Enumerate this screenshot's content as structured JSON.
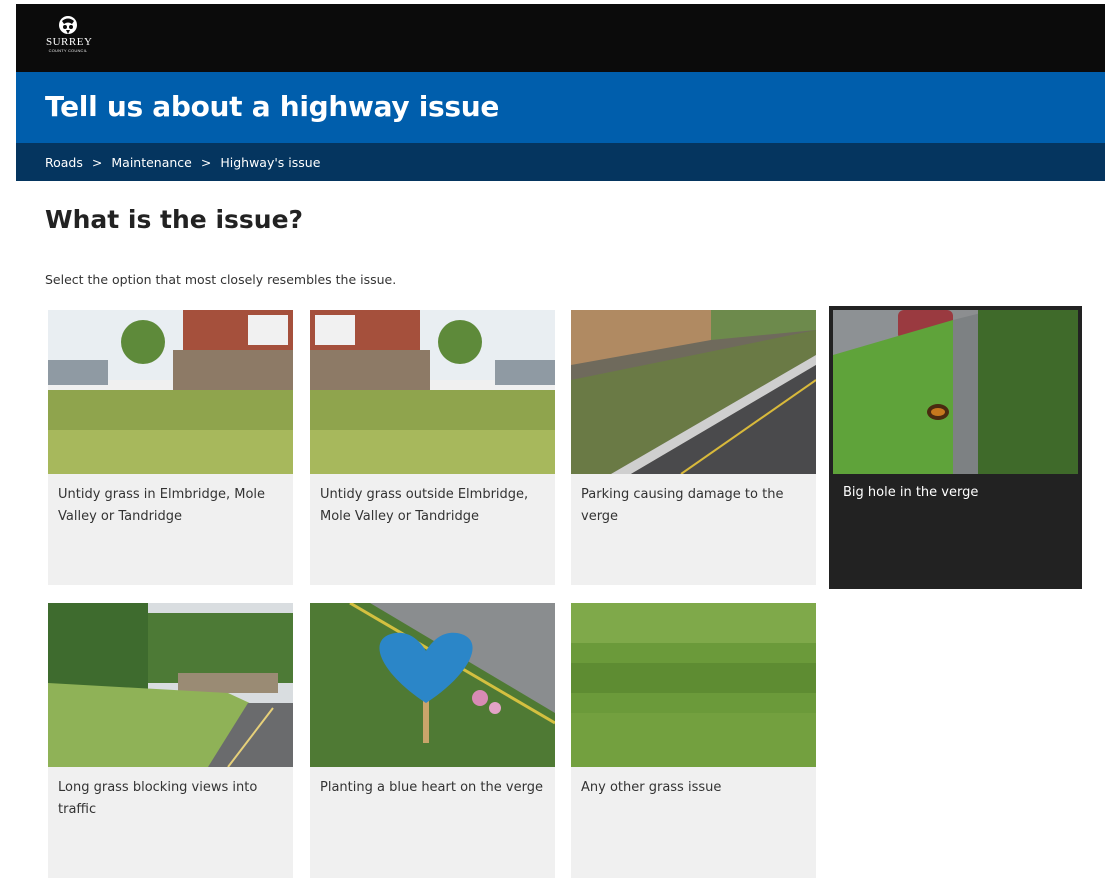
{
  "header": {
    "logo_text": "SURREY",
    "logo_subtext": "COUNTY COUNCIL",
    "title": "Tell us about a highway issue"
  },
  "breadcrumb": {
    "items": [
      "Roads",
      "Maintenance",
      "Highway's issue"
    ],
    "separator": ">"
  },
  "main": {
    "heading": "What is the issue?",
    "intro": "Select the option that most closely resembles the issue.",
    "options": [
      {
        "label": "Untidy grass in Elmbridge, Mole Valley or Tandridge",
        "image": "houses-fence-grass-photo",
        "selected": false
      },
      {
        "label": "Untidy grass outside Elmbridge, Mole Valley or Tandridge",
        "image": "houses-fence-grass-mirrored-photo",
        "selected": false
      },
      {
        "label": "Parking causing damage to the verge",
        "image": "damaged-verge-road-photo",
        "selected": false
      },
      {
        "label": "Big hole in the verge",
        "image": "hole-in-verge-photo",
        "selected": true
      },
      {
        "label": "Long grass blocking views into traffic",
        "image": "long-grass-road-photo",
        "selected": false
      },
      {
        "label": "Planting a blue heart on the verge",
        "image": "blue-heart-sign-photo",
        "selected": false
      },
      {
        "label": "Any other grass issue",
        "image": "grass-closeup-photo",
        "selected": false
      }
    ]
  },
  "colors": {
    "topbar": "#0b0b0b",
    "titlebar": "#005eac",
    "breadcrumb": "#05355f",
    "tile_bg": "#f0f0f0",
    "tile_selected_bg": "#222222"
  }
}
